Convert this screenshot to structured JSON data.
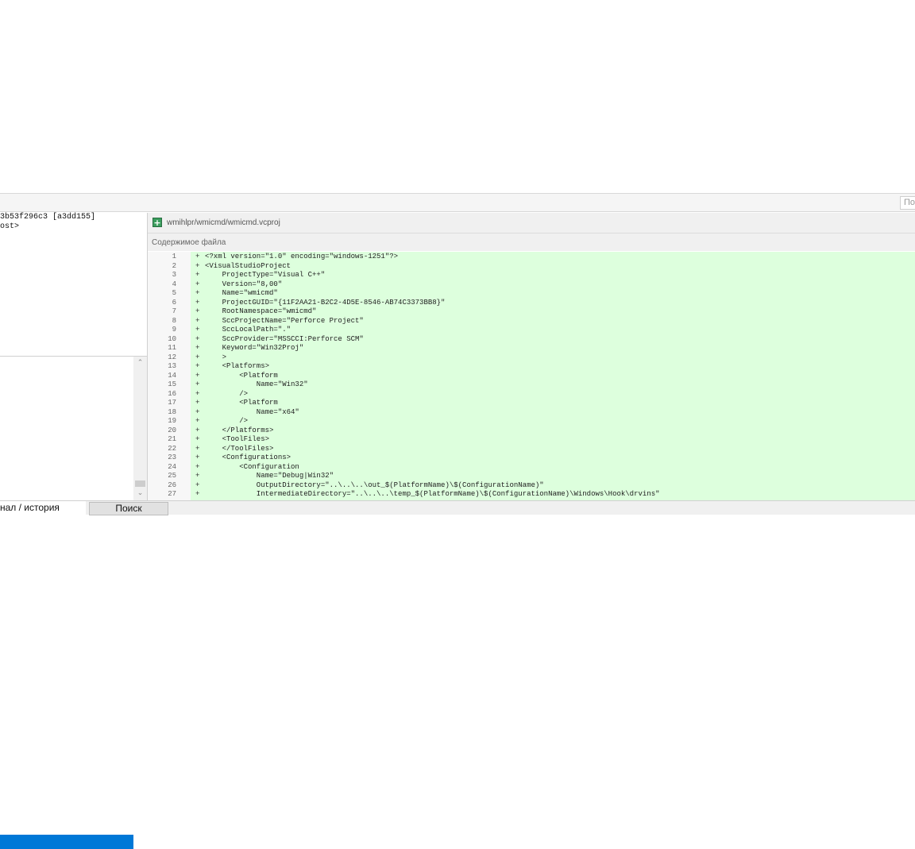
{
  "toolbar": {
    "search_placeholder": "По"
  },
  "left_panel": {
    "lines": [
      "3b53f296c3 [a3dd155]",
      "ost>"
    ]
  },
  "file": {
    "path": "wmihlpr/wmicmd/wmicmd.vcproj",
    "content_label": "Содержимое файла",
    "status_icon": "plus-icon",
    "lines": [
      {
        "n": "1",
        "t": "<?xml version=\"1.0\" encoding=\"windows-1251\"?>"
      },
      {
        "n": "2",
        "t": "<VisualStudioProject"
      },
      {
        "n": "3",
        "t": "    ProjectType=\"Visual C++\""
      },
      {
        "n": "4",
        "t": "    Version=\"8,00\""
      },
      {
        "n": "5",
        "t": "    Name=\"wmicmd\""
      },
      {
        "n": "6",
        "t": "    ProjectGUID=\"{11F2AA21-B2C2-4D5E-8546-AB74C3373BB8}\""
      },
      {
        "n": "7",
        "t": "    RootNamespace=\"wmicmd\""
      },
      {
        "n": "8",
        "t": "    SccProjectName=\"Perforce Project\""
      },
      {
        "n": "9",
        "t": "    SccLocalPath=\".\""
      },
      {
        "n": "10",
        "t": "    SccProvider=\"MSSCCI:Perforce SCM\""
      },
      {
        "n": "11",
        "t": "    Keyword=\"Win32Proj\""
      },
      {
        "n": "12",
        "t": "    >"
      },
      {
        "n": "13",
        "t": "    <Platforms>"
      },
      {
        "n": "14",
        "t": "        <Platform"
      },
      {
        "n": "15",
        "t": "            Name=\"Win32\""
      },
      {
        "n": "16",
        "t": "        />"
      },
      {
        "n": "17",
        "t": "        <Platform"
      },
      {
        "n": "18",
        "t": "            Name=\"x64\""
      },
      {
        "n": "19",
        "t": "        />"
      },
      {
        "n": "20",
        "t": "    </Platforms>"
      },
      {
        "n": "21",
        "t": "    <ToolFiles>"
      },
      {
        "n": "22",
        "t": "    </ToolFiles>"
      },
      {
        "n": "23",
        "t": "    <Configurations>"
      },
      {
        "n": "24",
        "t": "        <Configuration"
      },
      {
        "n": "25",
        "t": "            Name=\"Debug|Win32\""
      },
      {
        "n": "26",
        "t": "            OutputDirectory=\"..\\..\\..\\out_$(PlatformName)\\$(ConfigurationName)\""
      },
      {
        "n": "27",
        "t": "            IntermediateDirectory=\"..\\..\\..\\temp_$(PlatformName)\\$(ConfigurationName)\\Windows\\Hook\\drvins\""
      }
    ]
  },
  "tabs": {
    "history_label": "нал / история",
    "search_label": "Поиск"
  },
  "colors": {
    "added_bg": "#ddffdd",
    "selection": "#0078d7",
    "add_icon": "#3a9d5d"
  }
}
